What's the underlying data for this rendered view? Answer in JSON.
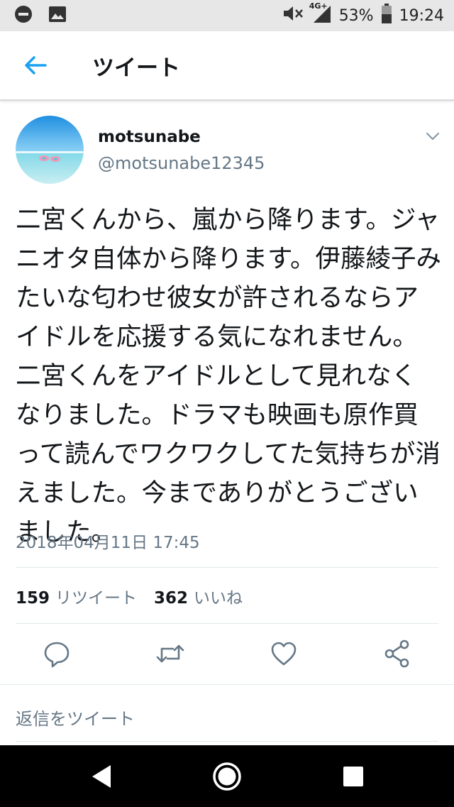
{
  "status_bar": {
    "network": "4G+",
    "battery": "53%",
    "time": "19:24",
    "icons": [
      "dnd-icon",
      "image-icon",
      "mute-icon",
      "signal-icon",
      "battery-icon"
    ]
  },
  "header": {
    "title": "ツイート",
    "back_icon": "arrow-left-icon"
  },
  "tweet": {
    "display_name": "motsunabe",
    "handle": "@motsunabe12345",
    "text": "二宮くんから、嵐から降ります。ジャニオタ自体から降ります。伊藤綾子みたいな匂わせ彼女が許されるならアイドルを応援する気になれません。二宮くんをアイドルとして見れなくなりました。ドラマも映画も原作買って読んでワクワクしてた気持ちが消えました。今までありがとうございました。",
    "timestamp": "2018年04月11日 17:45",
    "retweet_count": "159",
    "retweet_label": "リツイート",
    "like_count": "362",
    "like_label": "いいね"
  },
  "actions": [
    "reply-icon",
    "retweet-icon",
    "like-icon",
    "share-icon"
  ],
  "reply": {
    "placeholder": "返信をツイート"
  },
  "colors": {
    "accent": "#1da1f2",
    "secondary_text": "#657786",
    "divider": "#e1e8ed"
  }
}
